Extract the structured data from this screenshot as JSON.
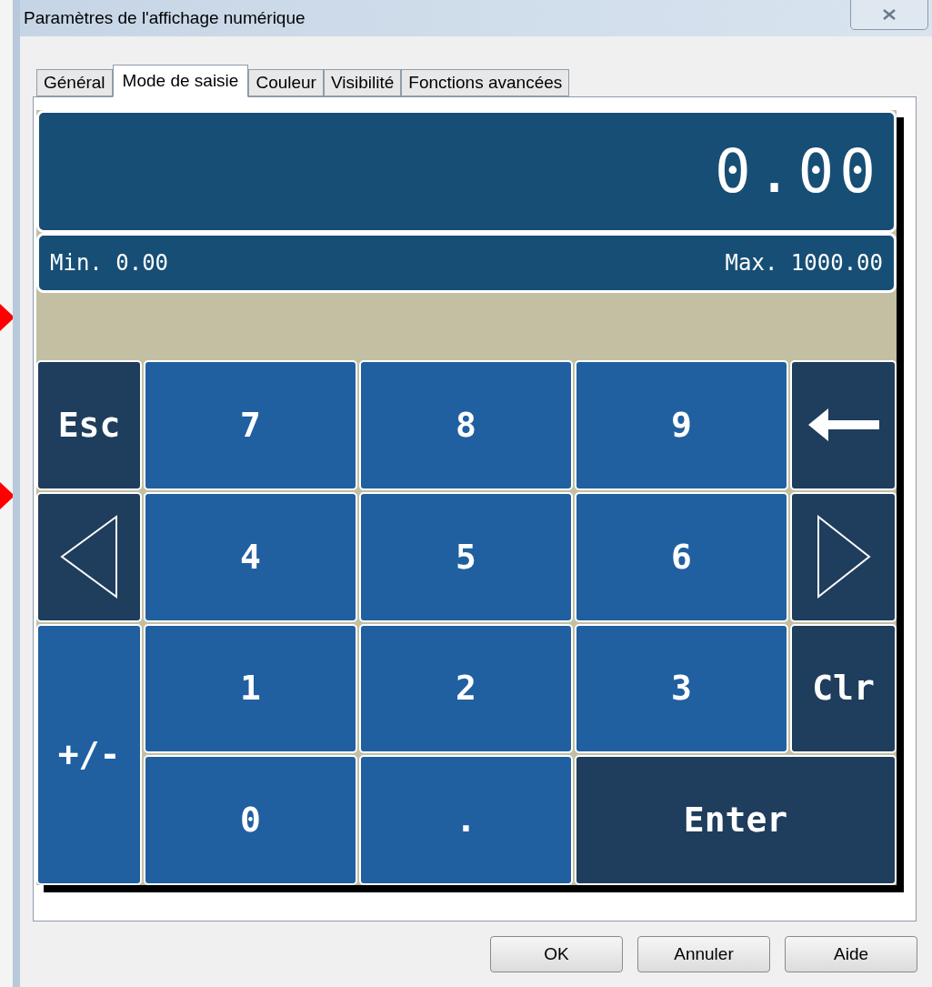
{
  "window": {
    "title": "Paramètres de l'affichage numérique"
  },
  "tabs": [
    {
      "label": "Général",
      "selected": false
    },
    {
      "label": "Mode de saisie",
      "selected": true
    },
    {
      "label": "Couleur",
      "selected": false
    },
    {
      "label": "Visibilité",
      "selected": false
    },
    {
      "label": "Fonctions avancées",
      "selected": false
    }
  ],
  "display": {
    "value": "0.00",
    "min": "Min. 0.00",
    "max": "Max. 1000.00"
  },
  "keys": [
    {
      "kind": "text",
      "label": "Esc"
    },
    {
      "kind": "text",
      "label": "7"
    },
    {
      "kind": "text",
      "label": "8"
    },
    {
      "kind": "text",
      "label": "9"
    },
    {
      "kind": "backspace"
    },
    {
      "kind": "left"
    },
    {
      "kind": "text",
      "label": "4"
    },
    {
      "kind": "text",
      "label": "5"
    },
    {
      "kind": "text",
      "label": "6"
    },
    {
      "kind": "right"
    },
    {
      "kind": "text",
      "label": "+/-"
    },
    {
      "kind": "text",
      "label": "1"
    },
    {
      "kind": "text",
      "label": "2"
    },
    {
      "kind": "text",
      "label": "3"
    },
    {
      "kind": "text",
      "label": "Clr"
    },
    {
      "kind": "text",
      "label": "0"
    },
    {
      "kind": "text",
      "label": "."
    },
    {
      "kind": "text",
      "label": "Enter"
    }
  ],
  "buttons": [
    "OK",
    "Annuler",
    "Aide"
  ]
}
